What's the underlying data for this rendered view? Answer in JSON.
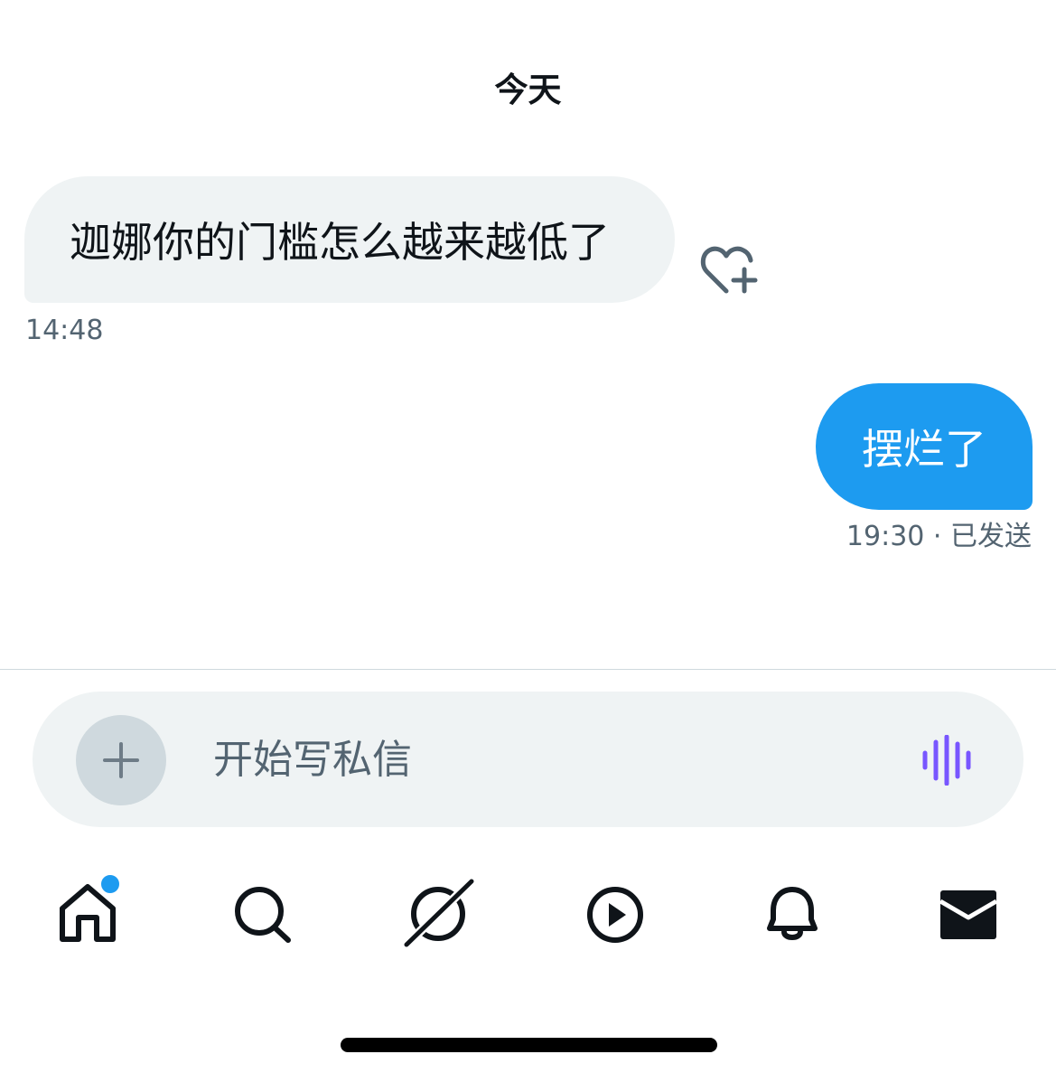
{
  "conversation": {
    "date_label": "今天",
    "messages": [
      {
        "direction": "incoming",
        "text": "迦娜你的门槛怎么越来越低了",
        "time": "14:48"
      },
      {
        "direction": "outgoing",
        "text": "摆烂了",
        "time": "19:30",
        "status": "· 已发送"
      }
    ],
    "react_icon": "heart-plus-icon"
  },
  "composer": {
    "placeholder": "开始写私信",
    "add_icon": "plus-icon",
    "voice_icon": "waveform-icon"
  },
  "tabbar": {
    "items": [
      {
        "icon": "home-icon",
        "has_notification_dot": true
      },
      {
        "icon": "search-icon"
      },
      {
        "icon": "grok-icon"
      },
      {
        "icon": "play-icon"
      },
      {
        "icon": "bell-icon"
      },
      {
        "icon": "mail-icon",
        "active": true
      }
    ]
  },
  "colors": {
    "accent": "#1d9bf0",
    "incoming_bubble": "#eff3f4",
    "secondary_text": "#536471",
    "voice_icon": "#7856ff"
  }
}
